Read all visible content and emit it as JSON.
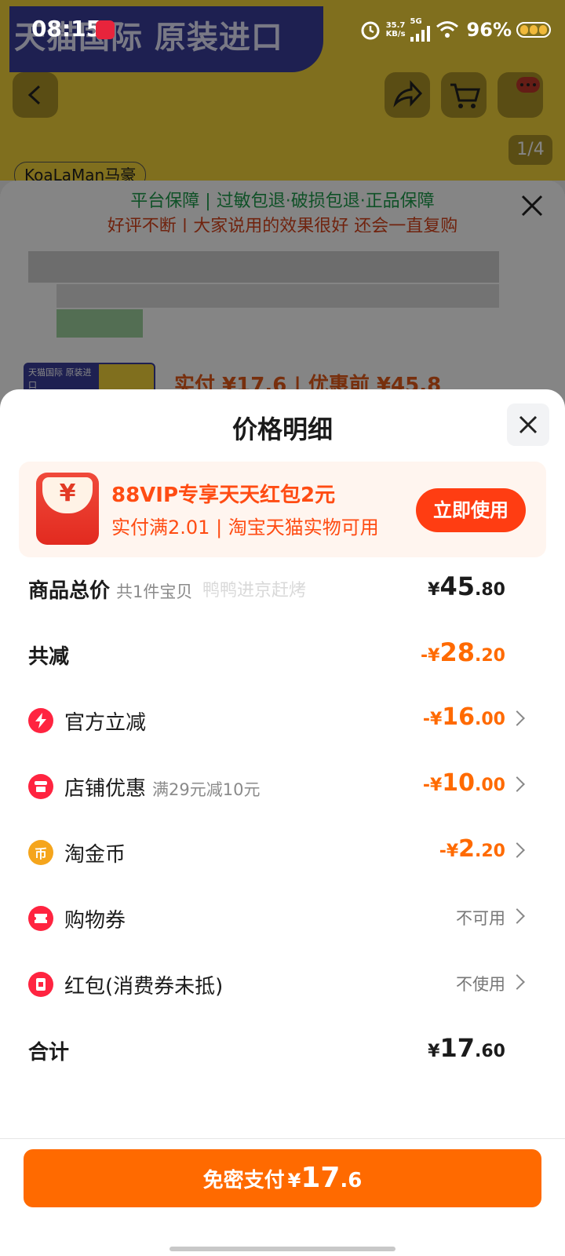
{
  "status_bar": {
    "time": "08:15",
    "net_speed_value": "35.7",
    "net_speed_unit": "KB/s",
    "network": "5G",
    "battery": "96%"
  },
  "background": {
    "banner_title": "天猫国际 原装进口",
    "pager": "1/4",
    "brand_tag": "KoaLaMan马豪",
    "guarantee": "平台保障 | 过敏包退·破损包退·正品保障",
    "slogan": "好评不断 | 大家说用的效果很好 还会一直复购",
    "thumb_label": "天猫国际 原装进口",
    "price_text": "实付 ¥17.6 | 优惠前 ¥45.8"
  },
  "sheet": {
    "title": "价格明细",
    "vip": {
      "icon_glyph": "¥",
      "title": "88VIP专享天天红包2元",
      "subtitle": "实付满2.01 | 淘宝天猫实物可用",
      "button": "立即使用"
    },
    "watermark": "鸭鸭进京赶烤",
    "rows": {
      "total_goods": {
        "label": "商品总价",
        "sub": "共1件宝贝",
        "yen": "¥",
        "int": "45",
        "dec": ".80"
      },
      "total_discount": {
        "label": "共减",
        "yen": "-¥",
        "int": "28",
        "dec": ".20"
      },
      "official": {
        "label": "官方立减",
        "yen": "-¥",
        "int": "16",
        "dec": ".00"
      },
      "shop": {
        "label": "店铺优惠",
        "sub": "满29元减10元",
        "yen": "-¥",
        "int": "10",
        "dec": ".00"
      },
      "coins": {
        "label": "淘金币",
        "icon_glyph": "币",
        "yen": "-¥",
        "int": "2",
        "dec": ".20"
      },
      "coupon": {
        "label": "购物券",
        "value": "不可用"
      },
      "redpacket": {
        "label": "红包(消费券未抵)",
        "value": "不使用"
      },
      "sum": {
        "label": "合计",
        "yen": "¥",
        "int": "17",
        "dec": ".60"
      }
    },
    "pay": {
      "label": "免密支付",
      "yen": "¥",
      "int": "17",
      "dec": ".6"
    }
  },
  "colors": {
    "accent": "#ff6a00",
    "vip_red": "#ff3d12",
    "guarantee_green": "#1d9b4b"
  }
}
